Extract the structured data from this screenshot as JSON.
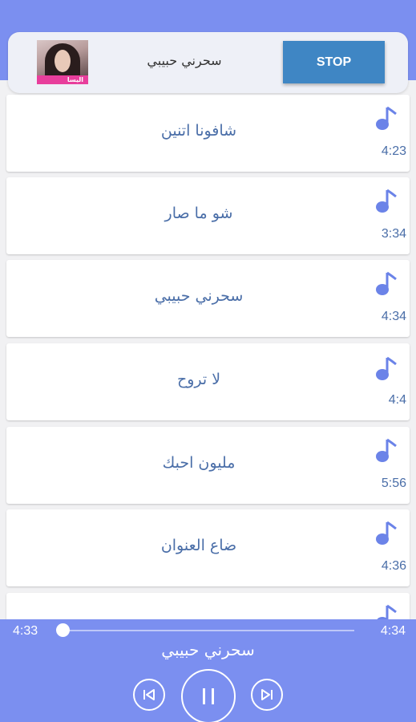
{
  "header": {
    "title": "سحرني حبيبي",
    "stop_label": "STOP",
    "album_band_text": "اليسا"
  },
  "songs": [
    {
      "title": "شافونا اتنين",
      "duration": "4:23"
    },
    {
      "title": "شو ما صار",
      "duration": "3:34"
    },
    {
      "title": "سحرني حبيبي",
      "duration": "4:34"
    },
    {
      "title": "لا تروح",
      "duration": "4:4"
    },
    {
      "title": "مليون احبك",
      "duration": "5:56"
    },
    {
      "title": "ضاع العنوان",
      "duration": "4:36"
    },
    {
      "title": "",
      "duration": ""
    }
  ],
  "player": {
    "current_time": "4:33",
    "total_time": "4:34",
    "title": "سحرني حبيبي",
    "progress": 0.0
  },
  "icons": {
    "song": "music-note-icon",
    "prev": "skip-previous-icon",
    "play": "pause-icon",
    "next": "skip-next-icon"
  },
  "colors": {
    "primary": "#7b8ff0",
    "accent": "#3f86c4",
    "text": "#4a6ea8",
    "note": "#6b83e8"
  }
}
